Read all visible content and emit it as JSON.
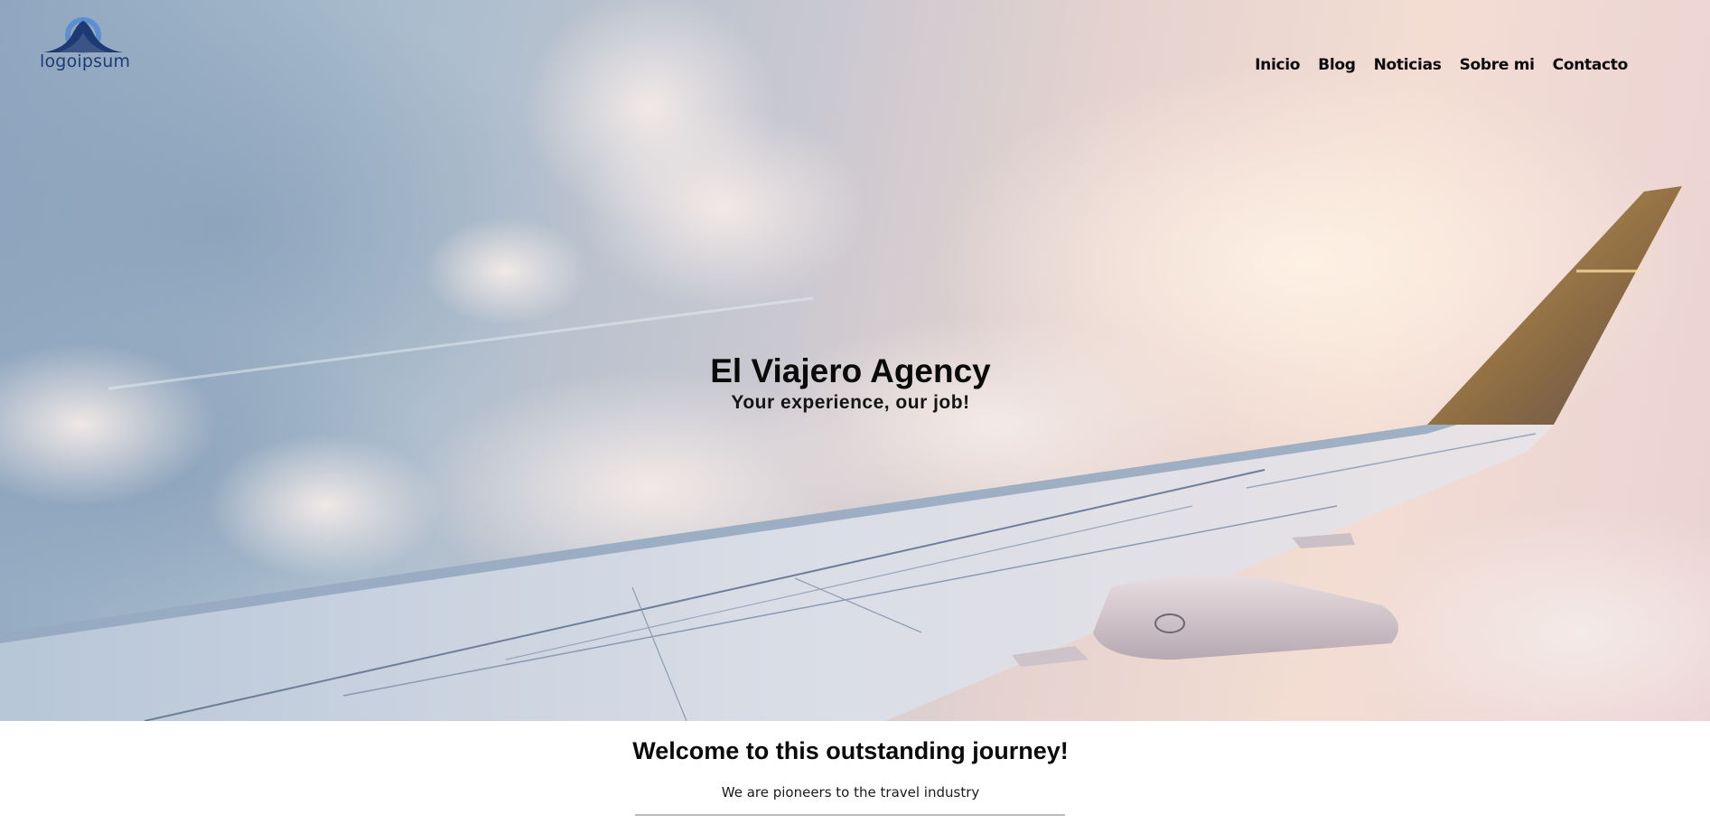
{
  "brand": {
    "logo_text": "logoipsum",
    "logo_color": "#1d3a73",
    "logo_accent": "#5b8fd0"
  },
  "nav": {
    "items": [
      {
        "label": "Inicio"
      },
      {
        "label": "Blog"
      },
      {
        "label": "Noticias"
      },
      {
        "label": "Sobre mi"
      },
      {
        "label": "Contacto"
      }
    ]
  },
  "hero": {
    "title": "El Viajero Agency",
    "subtitle": "Your experience, our job!",
    "background_image": "airplane-wing-over-clouds"
  },
  "welcome": {
    "title": "Welcome to this outstanding journey!",
    "text": "We are pioneers to the travel industry"
  }
}
